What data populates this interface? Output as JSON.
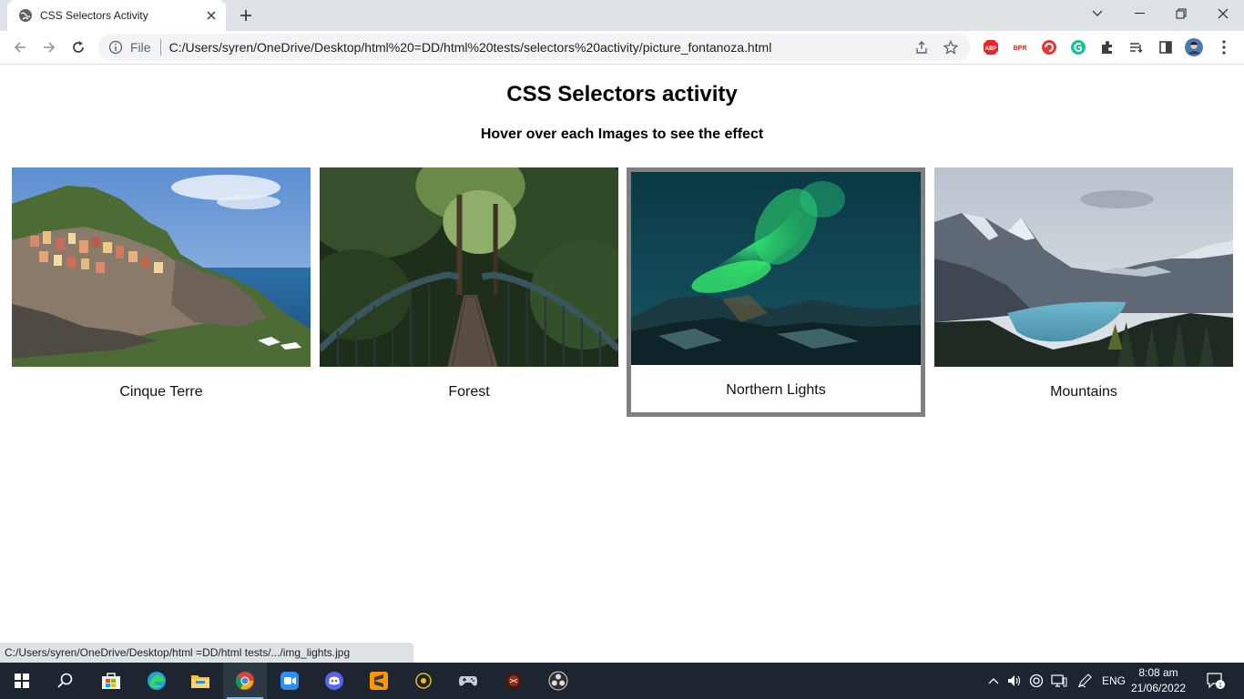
{
  "browser": {
    "tab_title": "CSS Selectors Activity",
    "file_label": "File",
    "url": "C:/Users/syren/OneDrive/Desktop/html%20=DD/html%20tests/selectors%20activity/picture_fontanoza.html",
    "status_url": "C:/Users/syren/OneDrive/Desktop/html =DD/html tests/.../img_lights.jpg"
  },
  "page": {
    "title": "CSS Selectors activity",
    "subtitle": "Hover over each Images to see the effect",
    "cards": [
      {
        "caption": "Cinque Terre",
        "hovered": false
      },
      {
        "caption": "Forest",
        "hovered": false
      },
      {
        "caption": "Northern Lights",
        "hovered": true
      },
      {
        "caption": "Mountains",
        "hovered": false
      }
    ]
  },
  "extensions": [
    "adblock-plus-icon",
    "bpr-icon",
    "red-circle-extension-icon",
    "grammarly-icon",
    "puzzle-extensions-icon",
    "reading-list-icon",
    "side-panel-icon",
    "profile-avatar-icon",
    "more-menu-icon"
  ],
  "taskbar": {
    "apps": [
      "start-icon",
      "search-icon",
      "microsoft-store-icon",
      "edge-icon",
      "file-explorer-icon",
      "chrome-icon",
      "zoom-icon",
      "discord-icon",
      "sublime-text-icon",
      "game-app-icon",
      "controller-icon",
      "dark-app-icon",
      "obs-icon"
    ],
    "lang": "ENG",
    "time": "8:08 am",
    "date": "21/06/2022",
    "notification_count": "1"
  },
  "colors": {
    "tabstrip": "#dee1e6",
    "taskbar": "#1c2530",
    "hover_border": "#808080"
  }
}
